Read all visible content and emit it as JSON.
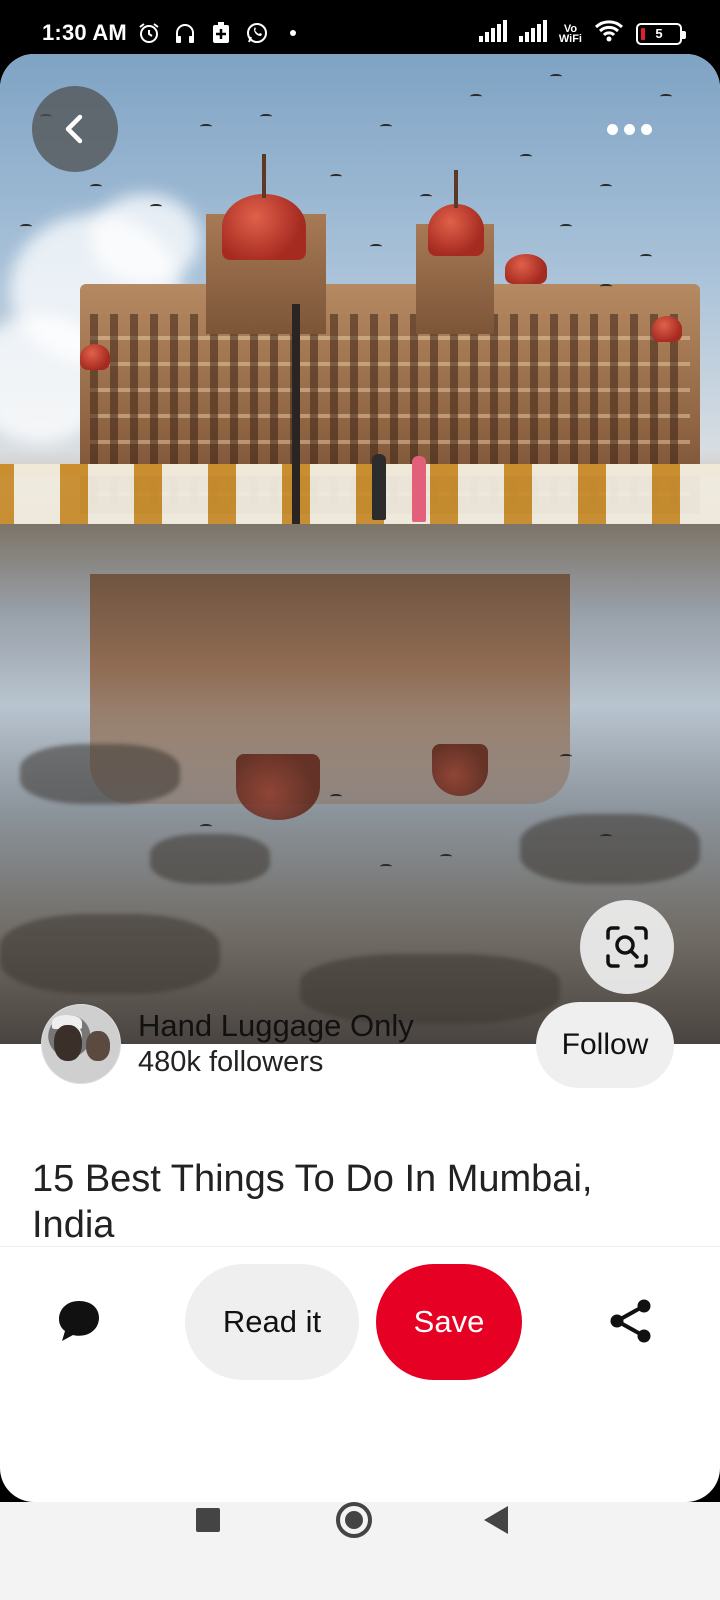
{
  "status_bar": {
    "time": "1:30 AM",
    "left_icons": [
      "alarm-icon",
      "headphones-icon",
      "battery-saver-icon",
      "whatsapp-icon",
      "dot-icon"
    ],
    "right_icons": [
      "signal-icon",
      "signal-icon",
      "vowifi-icon",
      "wifi-icon",
      "battery-icon"
    ],
    "vowifi_top": "Vo",
    "vowifi_bottom": "WiFi",
    "battery_level": "5"
  },
  "pin": {
    "image_icon_back": "chevron-left-icon",
    "image_icon_more": "more-horizontal-icon",
    "image_icon_lens": "visual-search-icon",
    "title": "15 Best Things To Do In Mumbai, India"
  },
  "creator": {
    "name": "Hand Luggage Only",
    "followers": "480k followers",
    "follow_label": "Follow"
  },
  "actions": {
    "comment_icon": "comment-icon",
    "read_label": "Read it",
    "save_label": "Save",
    "share_icon": "share-icon"
  },
  "colors": {
    "save_red": "#e60023",
    "button_grey": "#efefef"
  },
  "nav_bar": {
    "icons": [
      "recents-icon",
      "home-icon",
      "back-icon"
    ]
  }
}
